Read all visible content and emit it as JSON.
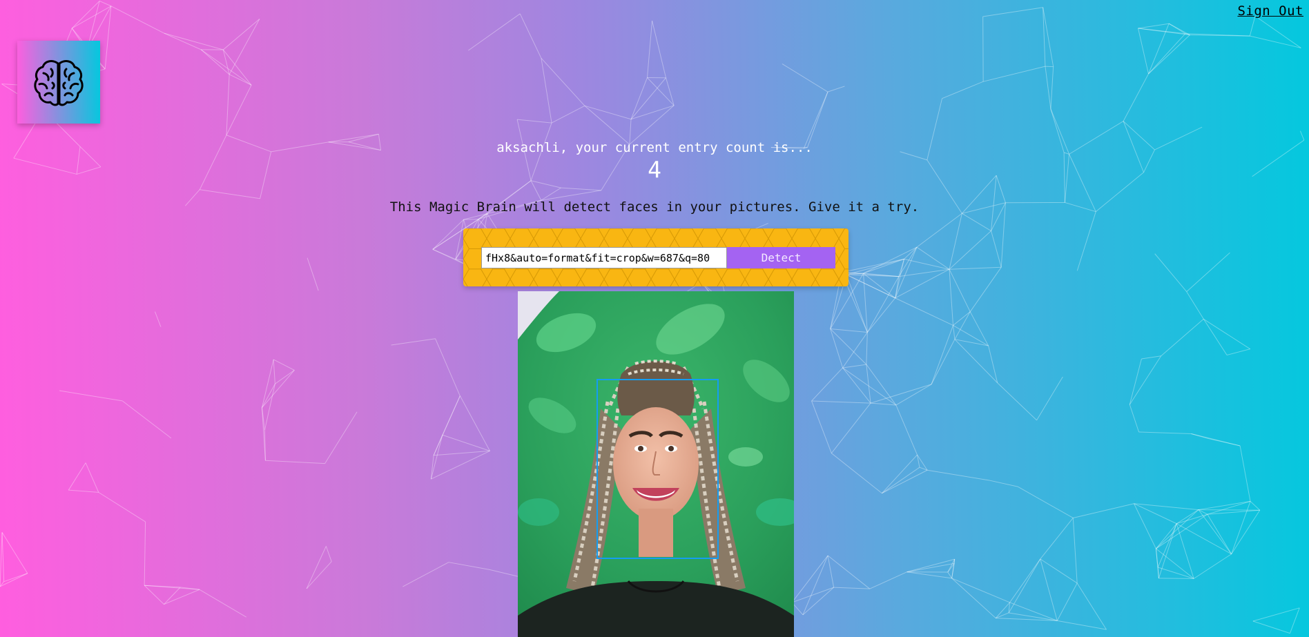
{
  "header": {
    "signout_label": "Sign Out"
  },
  "logo": {
    "icon": "brain-icon"
  },
  "rank": {
    "message": "aksachli, your current entry count is...",
    "count": "4"
  },
  "intro": {
    "text": "This Magic Brain will detect faces in your pictures. Give it a try."
  },
  "form": {
    "url_value": "fHx8&auto=format&fit=crop&w=687&q=80",
    "detect_label": "Detect"
  },
  "colors": {
    "gradient_start": "#ff5edf",
    "gradient_end": "#04c8de",
    "form_background": "#f9b612",
    "button": "#a463f2",
    "face_box": "#149df2"
  }
}
